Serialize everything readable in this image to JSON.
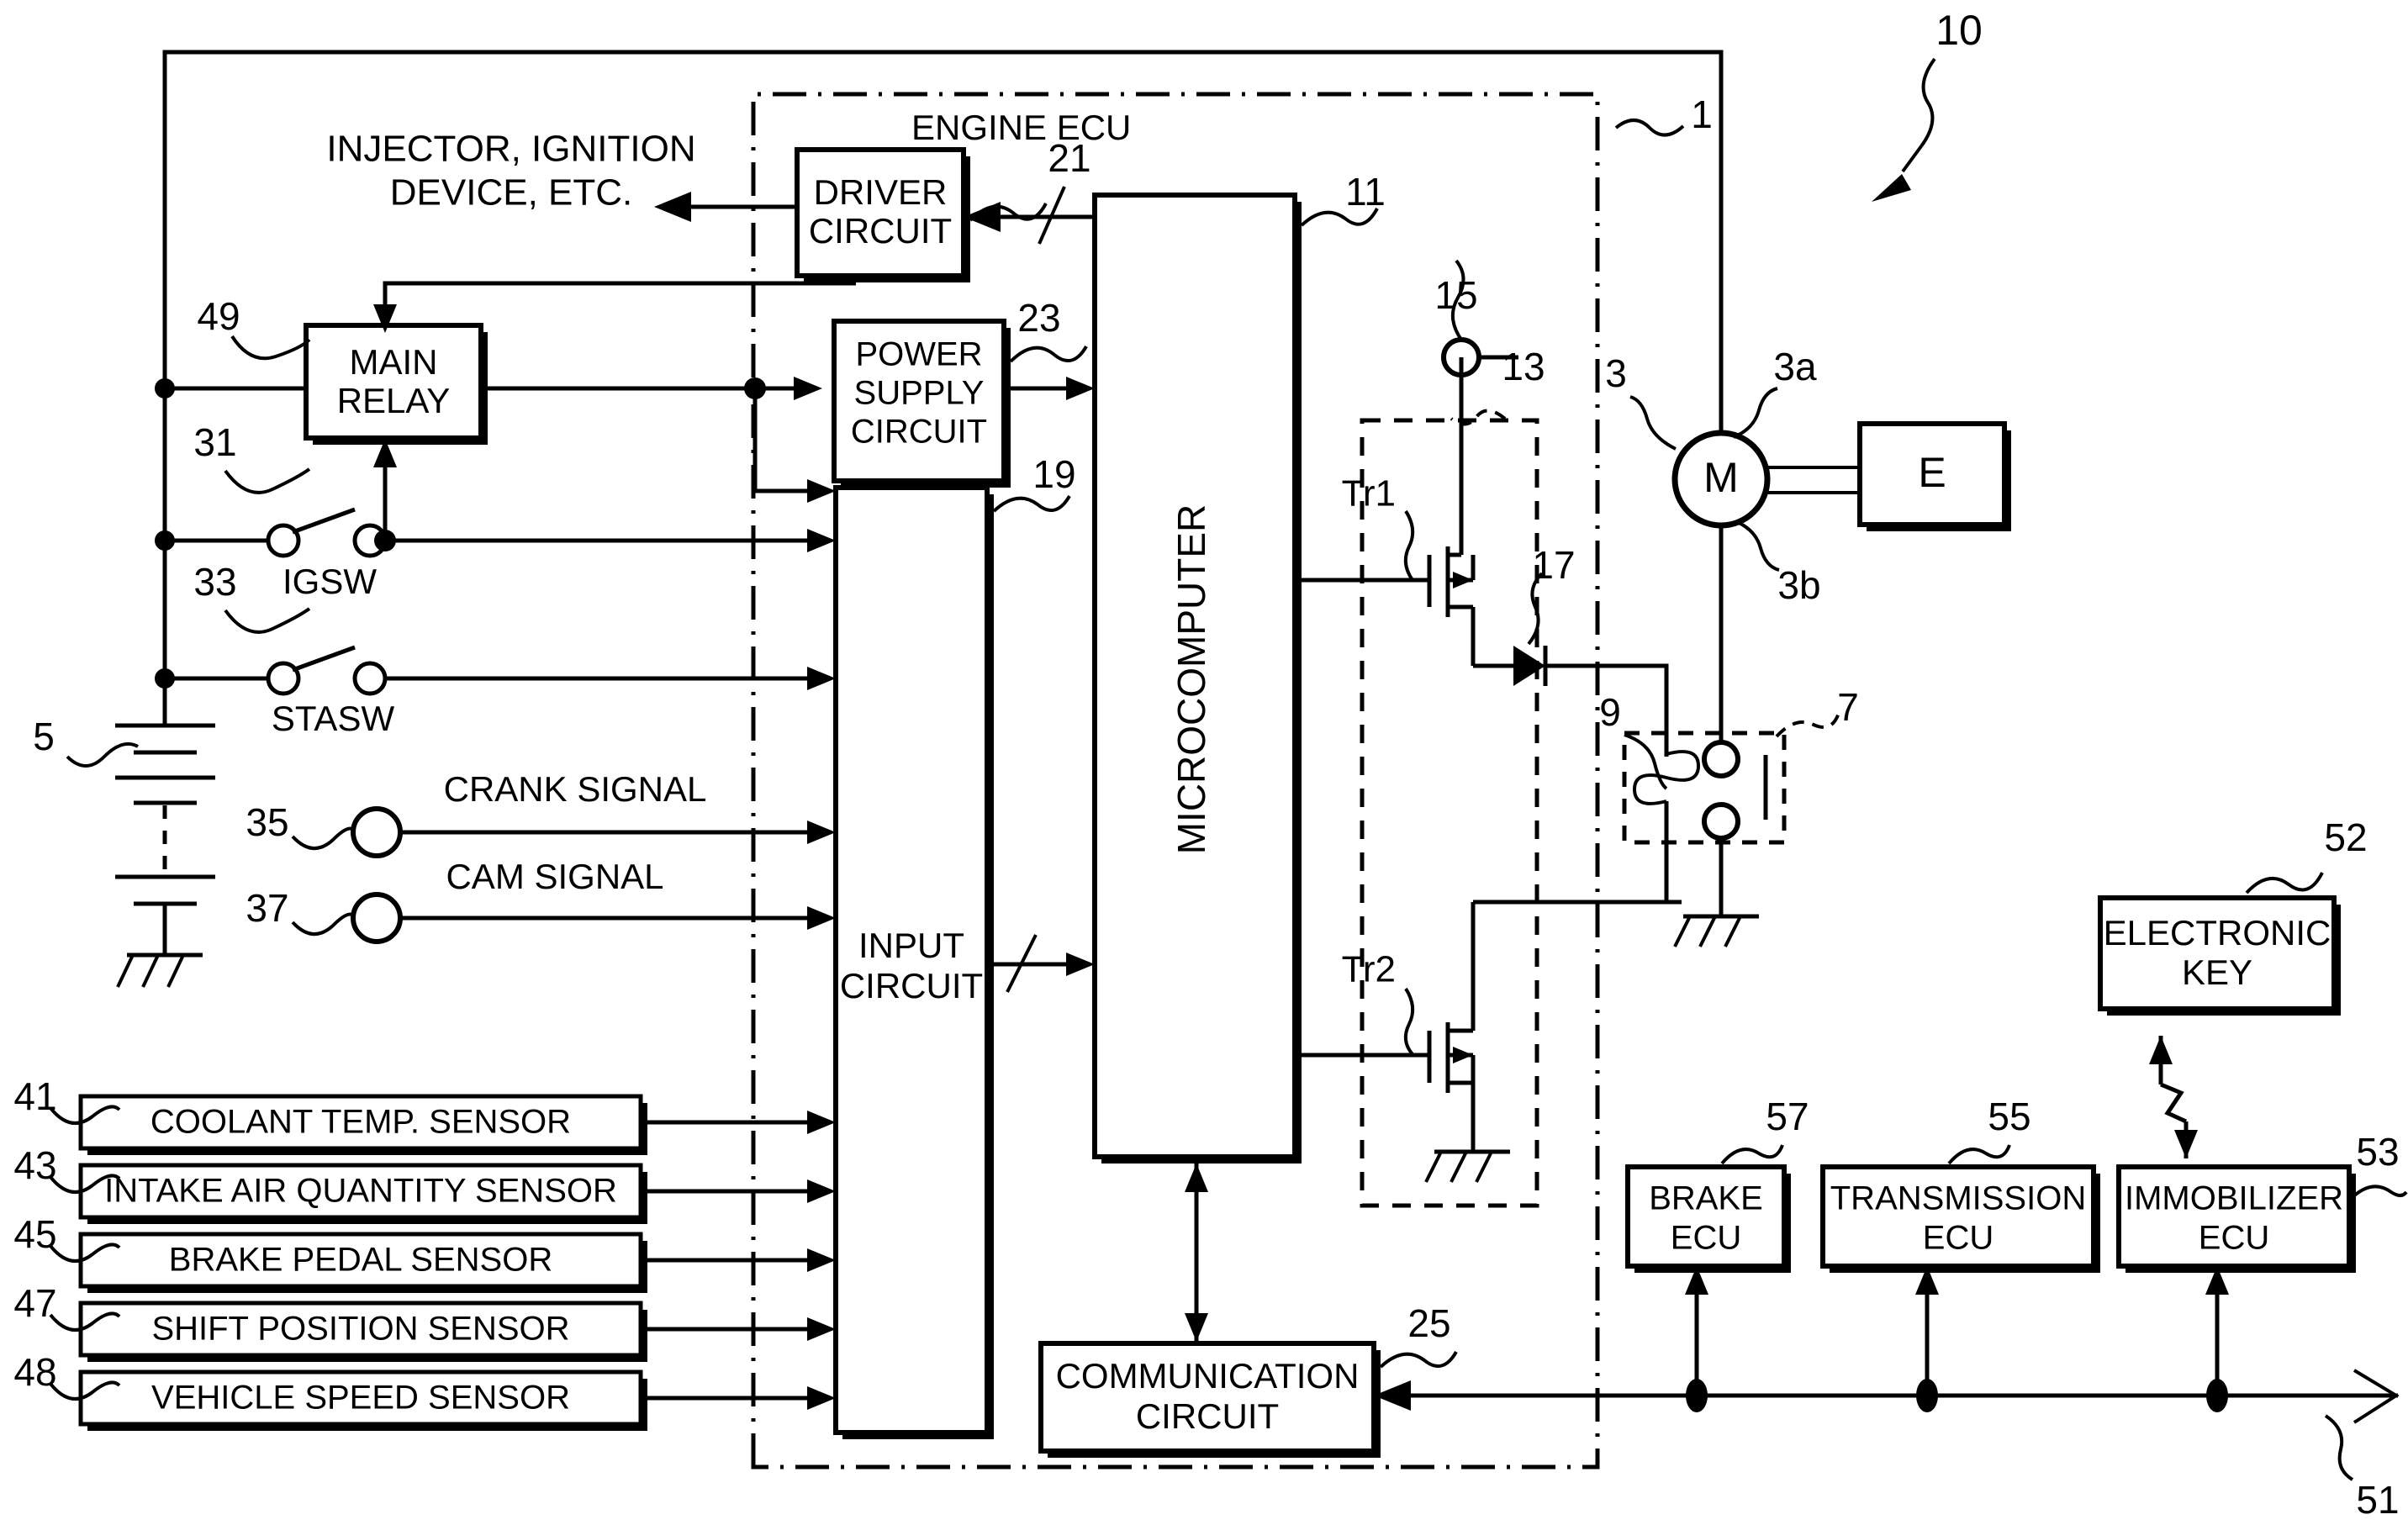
{
  "figure": {
    "overall_ref": "10",
    "ecu_title": "ENGINE ECU",
    "ecu_ref": "1"
  },
  "blocks": {
    "driver_circuit": {
      "line1": "DRIVER",
      "line2": "CIRCUIT",
      "ref": "21"
    },
    "power_supply_circuit": {
      "line1": "POWER",
      "line2": "SUPPLY",
      "line3": "CIRCUIT",
      "ref": "23"
    },
    "input_circuit": {
      "line1": "INPUT",
      "line2": "CIRCUIT",
      "ref": "19"
    },
    "microcomputer": {
      "label": "MICROCOMPUTER",
      "ref": "11"
    },
    "communication_circuit": {
      "line1": "COMMUNICATION",
      "line2": "CIRCUIT",
      "ref": "25"
    },
    "main_relay": {
      "line1": "MAIN",
      "line2": "RELAY",
      "ref": "49"
    },
    "electronic_key": {
      "line1": "ELECTRONIC",
      "line2": "KEY",
      "ref": "52"
    },
    "brake_ecu": {
      "line1": "BRAKE",
      "line2": "ECU",
      "ref": "57"
    },
    "transmission_ecu": {
      "line1": "TRANSMISSION",
      "line2": "ECU",
      "ref": "55"
    },
    "immobilizer_ecu": {
      "line1": "IMMOBILIZER",
      "line2": "ECU",
      "ref": "53"
    },
    "engine": {
      "label": "E"
    },
    "motor": {
      "label": "M",
      "ref": "3",
      "terminal_top_ref": "3a",
      "terminal_bottom_ref": "3b"
    }
  },
  "sensors": [
    {
      "ref": "41",
      "label": "COOLANT TEMP. SENSOR"
    },
    {
      "ref": "43",
      "label": "INTAKE AIR QUANTITY SENSOR"
    },
    {
      "ref": "45",
      "label": "BRAKE PEDAL SENSOR"
    },
    {
      "ref": "47",
      "label": "SHIFT POSITION SENSOR"
    },
    {
      "ref": "48",
      "label": "VEHICLE SPEED SENSOR"
    }
  ],
  "signals": {
    "crank": {
      "ref": "35",
      "label": "CRANK SIGNAL"
    },
    "cam": {
      "ref": "37",
      "label": "CAM SIGNAL"
    },
    "output_load": {
      "line1": "INJECTOR, IGNITION",
      "line2": "DEVICE, ETC."
    }
  },
  "switches": {
    "igsw": {
      "ref": "31",
      "label": "IGSW"
    },
    "stasw": {
      "ref": "33",
      "label": "STASW"
    }
  },
  "power": {
    "battery_ref": "5"
  },
  "drive_stage": {
    "dashed_block_ref": "13",
    "terminal_ref": "15",
    "transistor_high": "Tr1",
    "transistor_low": "Tr2",
    "diode_ref": "17"
  },
  "starter_relay": {
    "relay_ref": "7",
    "coil_ref": "9"
  },
  "bus": {
    "ref": "51"
  }
}
